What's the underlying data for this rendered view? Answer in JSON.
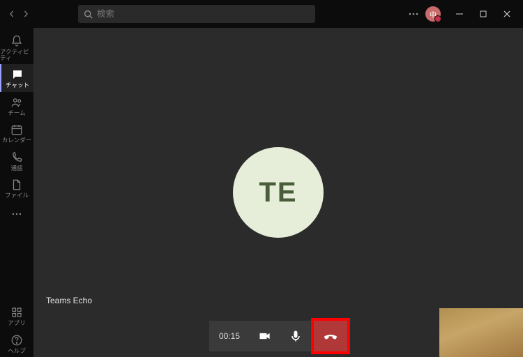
{
  "titlebar": {
    "search_placeholder": "検索",
    "avatar_initial": "中"
  },
  "sidebar": {
    "items": [
      {
        "label": "アクティビティ"
      },
      {
        "label": "チャット"
      },
      {
        "label": "チーム"
      },
      {
        "label": "カレンダー"
      },
      {
        "label": "通話"
      },
      {
        "label": "ファイル"
      }
    ],
    "bottom": [
      {
        "label": "アプリ"
      },
      {
        "label": "ヘルプ"
      }
    ]
  },
  "call": {
    "participant_initials": "TE",
    "participant_name": "Teams Echo",
    "duration": "00:15"
  },
  "colors": {
    "avatar_bg": "#e6eed9",
    "avatar_fg": "#4a5d3a",
    "hangup_bg": "#b03838",
    "highlight": "#ff0000"
  }
}
